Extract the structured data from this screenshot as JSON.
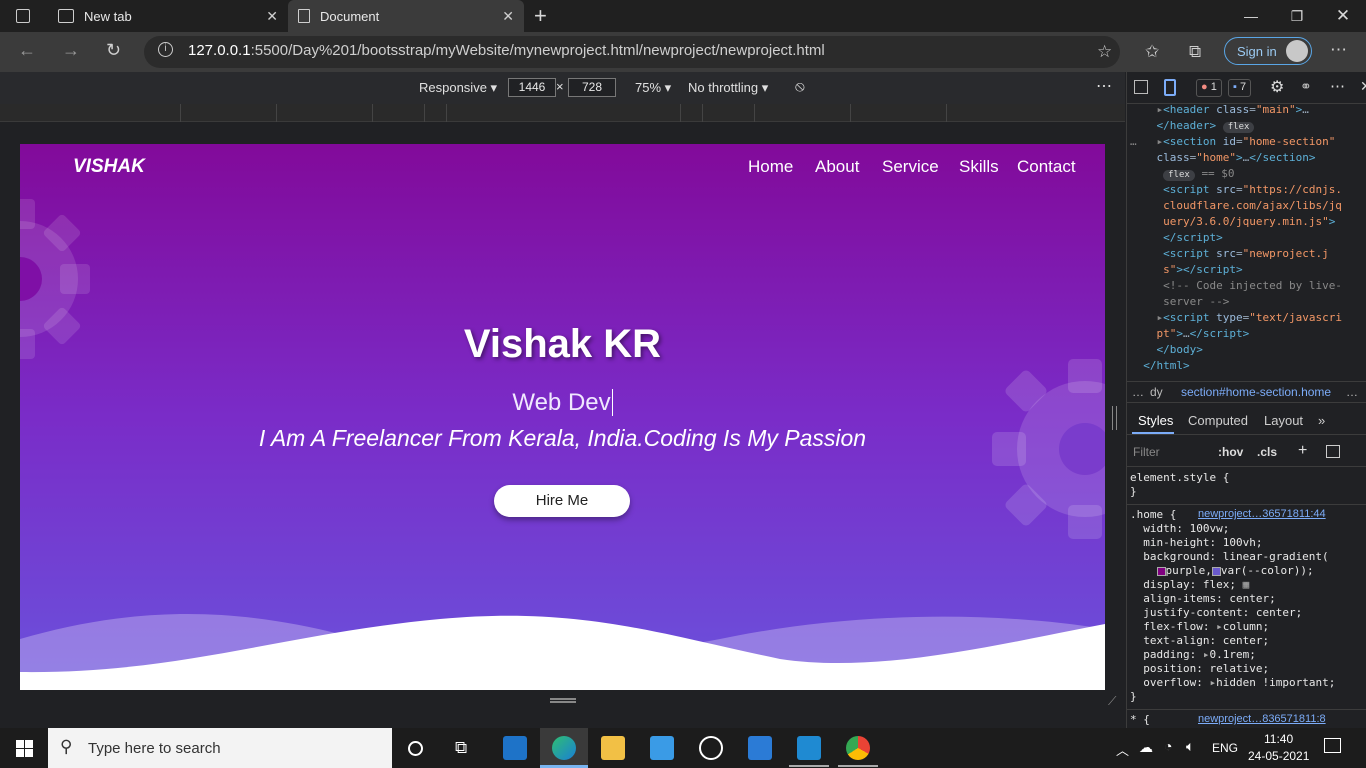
{
  "browser": {
    "tabs": [
      {
        "label": "New tab"
      },
      {
        "label": "Document"
      }
    ],
    "url_host": "127.0.0.1",
    "url_rest": ":5500/Day%201/bootsstrap/myWebsite/mynewproject.html/newproject/newproject.html",
    "sign_in_label": "Sign in"
  },
  "device_toolbar": {
    "mode": "Responsive",
    "width": "1446",
    "height": "728",
    "zoom": "75%",
    "throttling": "No throttling",
    "times": "×"
  },
  "page": {
    "logo": "VISHAK",
    "nav": [
      "Home",
      "About",
      "Service",
      "Skills",
      "Contact"
    ],
    "name": "Vishak KR",
    "role": "Web Dev",
    "tagline": "I Am A Freelancer From Kerala, India.Coding Is My Passion",
    "hire_label": "Hire Me",
    "colors": {
      "gradient_top": "#820a9a",
      "gradient_bottom": "#6a52dc"
    }
  },
  "devtools": {
    "error_count": "1",
    "message_count": "7",
    "breadcrumb": "section#home-section.home",
    "breadcrumb_prefix": "dy",
    "side_tabs": [
      "Styles",
      "Computed",
      "Layout"
    ],
    "filter_placeholder": "Filter",
    "hov": ":hov",
    "cls": ".cls",
    "element_style": "element.style {",
    "home_selector": ".home {",
    "home_link": "newproject…36571811:44",
    "star_link": "newproject…836571811:8",
    "star_selector": "* {"
  },
  "taskbar": {
    "search_placeholder": "Type here to search",
    "lang": "ENG",
    "time": "11:40",
    "date": "24-05-2021"
  }
}
